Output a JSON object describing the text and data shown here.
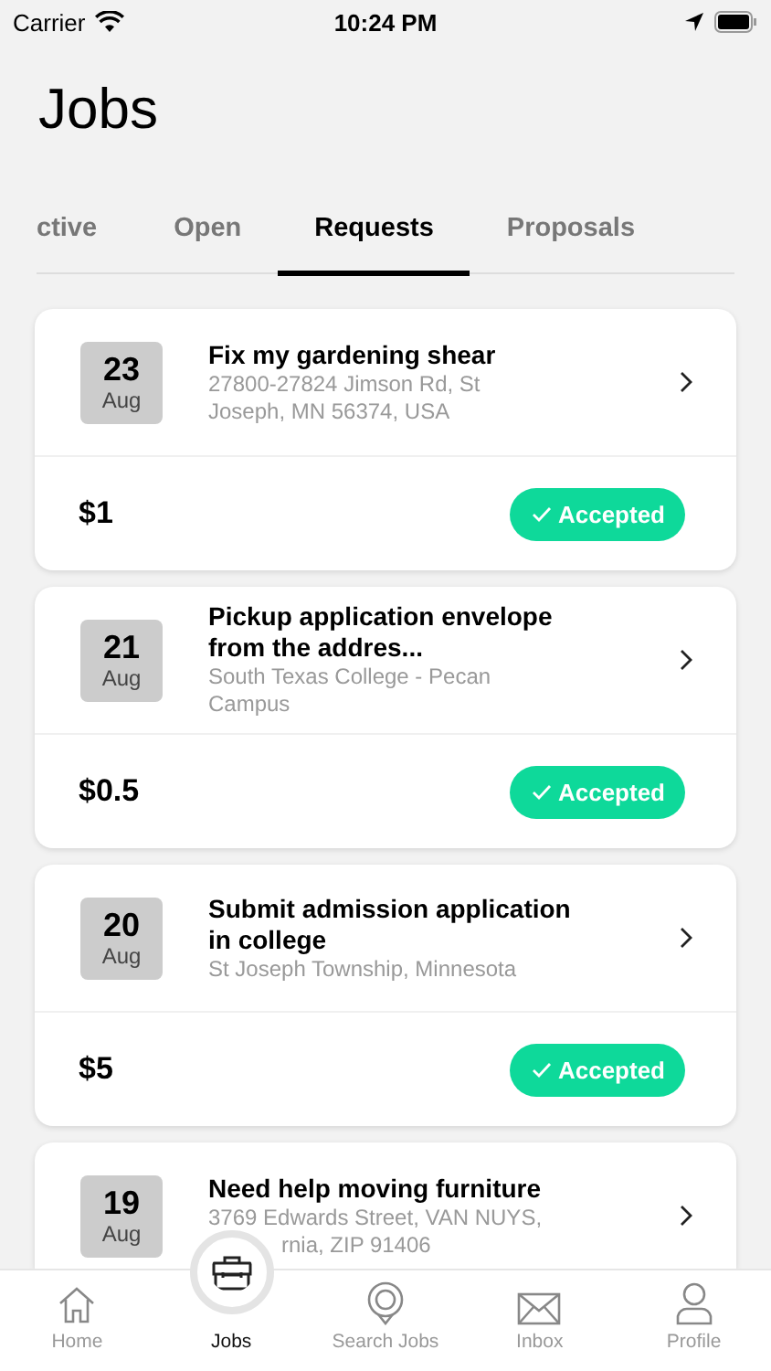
{
  "status_bar": {
    "carrier": "Carrier",
    "time": "10:24 PM"
  },
  "title": "Jobs",
  "tabs": [
    {
      "label": "ctive",
      "selected": false
    },
    {
      "label": "Open",
      "selected": false
    },
    {
      "label": "Requests",
      "selected": true
    },
    {
      "label": "Proposals",
      "selected": false
    }
  ],
  "jobs": [
    {
      "day": "23",
      "month": "Aug",
      "title": "Fix my gardening shear",
      "address": [
        "27800-27824 Jimson Rd, St",
        "Joseph, MN 56374, USA"
      ],
      "price": "$1",
      "status": "Accepted"
    },
    {
      "day": "21",
      "month": "Aug",
      "title": "Pickup application envelope from the addres...",
      "address": [
        "South Texas College - Pecan",
        "Campus"
      ],
      "price": "$0.5",
      "status": "Accepted"
    },
    {
      "day": "20",
      "month": "Aug",
      "title": "Submit admission application in college",
      "address": [
        "St Joseph Township, Minnesota"
      ],
      "price": "$5",
      "status": "Accepted"
    },
    {
      "day": "19",
      "month": "Aug",
      "title": "Need help moving furniture",
      "address": [
        "3769 Edwards Street, VAN NUYS,",
        "rnia, ZIP 91406"
      ]
    }
  ],
  "tab_bar": [
    {
      "label": "Home",
      "kind": "home",
      "selected": false
    },
    {
      "label": "Jobs",
      "kind": "jobs",
      "selected": true
    },
    {
      "label": "Search Jobs",
      "kind": "search",
      "selected": false
    },
    {
      "label": "Inbox",
      "kind": "inbox",
      "selected": false
    },
    {
      "label": "Profile",
      "kind": "profile",
      "selected": false
    }
  ]
}
